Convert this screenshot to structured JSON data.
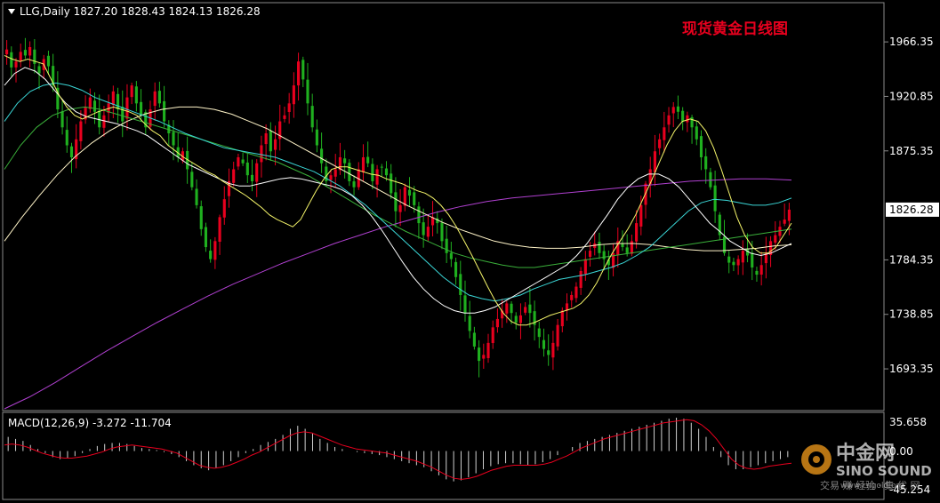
{
  "header": {
    "symbol_line": "LLG,Daily  1827.20 1828.43 1824.13 1826.28",
    "chart_title": "现货黄金日线图"
  },
  "macd": {
    "label": "MACD(12,26,9) -3.272 -11.704",
    "axis_top": "35.658",
    "axis_zero": "0.00",
    "axis_bottom": "-45.254"
  },
  "watermark": {
    "brand_cn": "中金网",
    "brand_en": "SINO SOUND",
    "url": "www.cngold.org",
    "slogan": "交易 赚 经验 · 集 优 网"
  },
  "colors": {
    "background": "#000000",
    "bull": "#e8001e",
    "bear": "#1fb01f",
    "ma_fast": "#f5f56a",
    "ma_mid": "#ffffff",
    "ma_cyan": "#3ad6d6",
    "ma_green": "#3ab03a",
    "ma_ivory": "#fff4c8",
    "ma_long": "#b040d0",
    "macd_signal": "#e8001e",
    "macd_hist": "#d0d0d0",
    "current_price_box": "#ffffff"
  },
  "chart_data": {
    "type": "candlestick",
    "title": "现货黄金日线图",
    "symbol": "LLG",
    "timeframe": "Daily",
    "last": {
      "open": 1827.2,
      "high": 1828.43,
      "low": 1824.13,
      "close": 1826.28
    },
    "ylim": [
      1660,
      1985
    ],
    "y_ticks": [
      1966.35,
      1920.85,
      1875.35,
      1826.28,
      1784.35,
      1738.85,
      1693.35
    ],
    "current_price": 1826.28,
    "macd": {
      "fast": 12,
      "slow": 26,
      "signal": 9,
      "macd_value": -3.272,
      "signal_value": -11.704,
      "ylim": [
        -45.254,
        35.658
      ]
    },
    "price_path": [
      1960,
      1945,
      1950,
      1958,
      1955,
      1962,
      1948,
      1940,
      1952,
      1946,
      1930,
      1910,
      1895,
      1880,
      1870,
      1885,
      1900,
      1912,
      1920,
      1908,
      1895,
      1905,
      1915,
      1925,
      1910,
      1900,
      1920,
      1930,
      1915,
      1905,
      1895,
      1910,
      1925,
      1915,
      1900,
      1890,
      1880,
      1870,
      1875,
      1860,
      1845,
      1830,
      1810,
      1795,
      1785,
      1800,
      1820,
      1835,
      1850,
      1860,
      1870,
      1865,
      1855,
      1850,
      1865,
      1880,
      1890,
      1875,
      1885,
      1900,
      1905,
      1915,
      1930,
      1950,
      1935,
      1915,
      1895,
      1880,
      1865,
      1850,
      1855,
      1860,
      1870,
      1865,
      1850,
      1845,
      1860,
      1870,
      1865,
      1850,
      1860,
      1862,
      1855,
      1840,
      1825,
      1830,
      1845,
      1838,
      1830,
      1815,
      1805,
      1812,
      1820,
      1815,
      1800,
      1790,
      1785,
      1770,
      1755,
      1740,
      1725,
      1712,
      1700,
      1705,
      1715,
      1728,
      1735,
      1742,
      1748,
      1740,
      1732,
      1738,
      1745,
      1740,
      1730,
      1720,
      1710,
      1705,
      1715,
      1730,
      1742,
      1748,
      1755,
      1762,
      1775,
      1785,
      1792,
      1798,
      1790,
      1785,
      1780,
      1790,
      1800,
      1795,
      1790,
      1800,
      1815,
      1830,
      1848,
      1860,
      1875,
      1885,
      1895,
      1905,
      1912,
      1908,
      1900,
      1905,
      1895,
      1885,
      1870,
      1860,
      1845,
      1825,
      1805,
      1790,
      1782,
      1780,
      1785,
      1792,
      1788,
      1778,
      1772,
      1780,
      1790,
      1800,
      1805,
      1812,
      1818,
      1826.28
    ],
    "ma_fast_path": [
      1955,
      1952,
      1950,
      1952,
      1950,
      1948,
      1935,
      1922,
      1912,
      1905,
      1902,
      1905,
      1908,
      1910,
      1912,
      1910,
      1908,
      1905,
      1898,
      1892,
      1888,
      1880,
      1875,
      1870,
      1866,
      1862,
      1858,
      1855,
      1850,
      1846,
      1842,
      1838,
      1833,
      1828,
      1822,
      1818,
      1815,
      1812,
      1818,
      1830,
      1842,
      1852,
      1860,
      1862,
      1862,
      1860,
      1858,
      1856,
      1855,
      1852,
      1850,
      1848,
      1845,
      1842,
      1840,
      1836,
      1830,
      1822,
      1812,
      1800,
      1788,
      1775,
      1762,
      1750,
      1740,
      1733,
      1730,
      1730,
      1732,
      1735,
      1738,
      1740,
      1742,
      1744,
      1748,
      1755,
      1765,
      1778,
      1790,
      1800,
      1810,
      1822,
      1836,
      1850,
      1865,
      1880,
      1892,
      1900,
      1902,
      1900,
      1892,
      1878,
      1860,
      1840,
      1820,
      1805,
      1795,
      1790,
      1790,
      1795,
      1805,
      1815
    ],
    "ma_mid_path": [
      1930,
      1940,
      1945,
      1942,
      1935,
      1925,
      1915,
      1908,
      1904,
      1902,
      1900,
      1898,
      1895,
      1892,
      1888,
      1882,
      1876,
      1870,
      1864,
      1860,
      1856,
      1852,
      1848,
      1846,
      1846,
      1848,
      1850,
      1852,
      1853,
      1852,
      1850,
      1848,
      1846,
      1843,
      1838,
      1830,
      1820,
      1808,
      1795,
      1782,
      1770,
      1760,
      1752,
      1746,
      1742,
      1740,
      1740,
      1742,
      1745,
      1750,
      1755,
      1760,
      1765,
      1770,
      1775,
      1780,
      1788,
      1798,
      1810,
      1822,
      1835,
      1845,
      1852,
      1856,
      1856,
      1852,
      1845,
      1835,
      1825,
      1815,
      1808,
      1800,
      1795,
      1790,
      1788,
      1790,
      1794,
      1798
    ],
    "ma_cyan_path": [
      1900,
      1915,
      1925,
      1930,
      1932,
      1930,
      1926,
      1920,
      1916,
      1912,
      1908,
      1904,
      1900,
      1895,
      1890,
      1886,
      1882,
      1878,
      1876,
      1874,
      1872,
      1870,
      1866,
      1862,
      1858,
      1852,
      1846,
      1838,
      1830,
      1820,
      1810,
      1800,
      1790,
      1780,
      1770,
      1762,
      1755,
      1752,
      1750,
      1752,
      1755,
      1760,
      1764,
      1768,
      1770,
      1772,
      1775,
      1778,
      1782,
      1788,
      1795,
      1805,
      1815,
      1825,
      1832,
      1835,
      1834,
      1832,
      1830,
      1830,
      1832,
      1836
    ],
    "ma_green_path": [
      1860,
      1880,
      1895,
      1905,
      1910,
      1912,
      1910,
      1906,
      1902,
      1898,
      1894,
      1890,
      1886,
      1882,
      1878,
      1874,
      1870,
      1866,
      1860,
      1854,
      1846,
      1838,
      1830,
      1822,
      1815,
      1808,
      1802,
      1796,
      1790,
      1786,
      1783,
      1780,
      1778,
      1778,
      1780,
      1782,
      1784,
      1786,
      1788,
      1790,
      1792,
      1794,
      1796,
      1798,
      1800,
      1802,
      1804,
      1806,
      1808,
      1810
    ],
    "ma_ivory_path": [
      1800,
      1820,
      1838,
      1855,
      1870,
      1882,
      1892,
      1900,
      1906,
      1910,
      1912,
      1912,
      1910,
      1906,
      1900,
      1894,
      1886,
      1878,
      1870,
      1862,
      1854,
      1846,
      1838,
      1830,
      1823,
      1816,
      1810,
      1805,
      1800,
      1797,
      1795,
      1794,
      1794,
      1795,
      1797,
      1798,
      1798,
      1797,
      1795,
      1793,
      1792,
      1792,
      1793,
      1794,
      1796,
      1797
    ],
    "ma_long_path": [
      1660,
      1670,
      1682,
      1695,
      1708,
      1720,
      1732,
      1743,
      1754,
      1764,
      1773,
      1782,
      1790,
      1798,
      1805,
      1812,
      1818,
      1824,
      1829,
      1833,
      1836,
      1838,
      1840,
      1842,
      1844,
      1846,
      1848,
      1850,
      1851,
      1852,
      1852,
      1851
    ],
    "macd_hist_path": [
      14,
      12,
      10,
      6,
      2,
      -2,
      -6,
      -8,
      -7,
      -5,
      -2,
      2,
      5,
      7,
      8,
      8,
      7,
      5,
      3,
      2,
      1,
      -1,
      -3,
      -6,
      -10,
      -14,
      -17,
      -19,
      -17,
      -14,
      -10,
      -6,
      -2,
      2,
      6,
      9,
      12,
      16,
      22,
      25,
      22,
      18,
      12,
      8,
      4,
      2,
      0,
      -1,
      -2,
      -3,
      -4,
      -6,
      -8,
      -10,
      -12,
      -14,
      -16,
      -20,
      -24,
      -28,
      -30,
      -29,
      -26,
      -22,
      -18,
      -15,
      -13,
      -12,
      -12,
      -13,
      -14,
      -13,
      -11,
      -8,
      -4,
      0,
      4,
      8,
      10,
      12,
      14,
      16,
      18,
      20,
      22,
      24,
      26,
      28,
      30,
      32,
      33,
      32,
      28,
      22,
      14,
      4,
      -6,
      -14,
      -18,
      -18,
      -16,
      -14,
      -12,
      -10,
      -8,
      -6
    ],
    "macd_signal_path": [
      6,
      7,
      6,
      4,
      1,
      -2,
      -4,
      -6,
      -7,
      -7,
      -6,
      -5,
      -3,
      -1,
      2,
      4,
      5,
      6,
      5,
      4,
      3,
      2,
      0,
      -2,
      -6,
      -10,
      -14,
      -16,
      -17,
      -16,
      -14,
      -11,
      -8,
      -4,
      -1,
      3,
      7,
      11,
      15,
      18,
      19,
      18,
      15,
      12,
      9,
      6,
      4,
      2,
      1,
      0,
      -1,
      -2,
      -4,
      -6,
      -8,
      -10,
      -13,
      -16,
      -20,
      -24,
      -27,
      -28,
      -27,
      -25,
      -22,
      -19,
      -17,
      -15,
      -14,
      -14,
      -14,
      -14,
      -13,
      -11,
      -8,
      -5,
      -1,
      3,
      6,
      9,
      12,
      14,
      16,
      18,
      20,
      22,
      24,
      26,
      28,
      29,
      30,
      31,
      30,
      26,
      20,
      12,
      2,
      -8,
      -14,
      -17,
      -18,
      -17,
      -15,
      -14,
      -13,
      -12
    ]
  }
}
